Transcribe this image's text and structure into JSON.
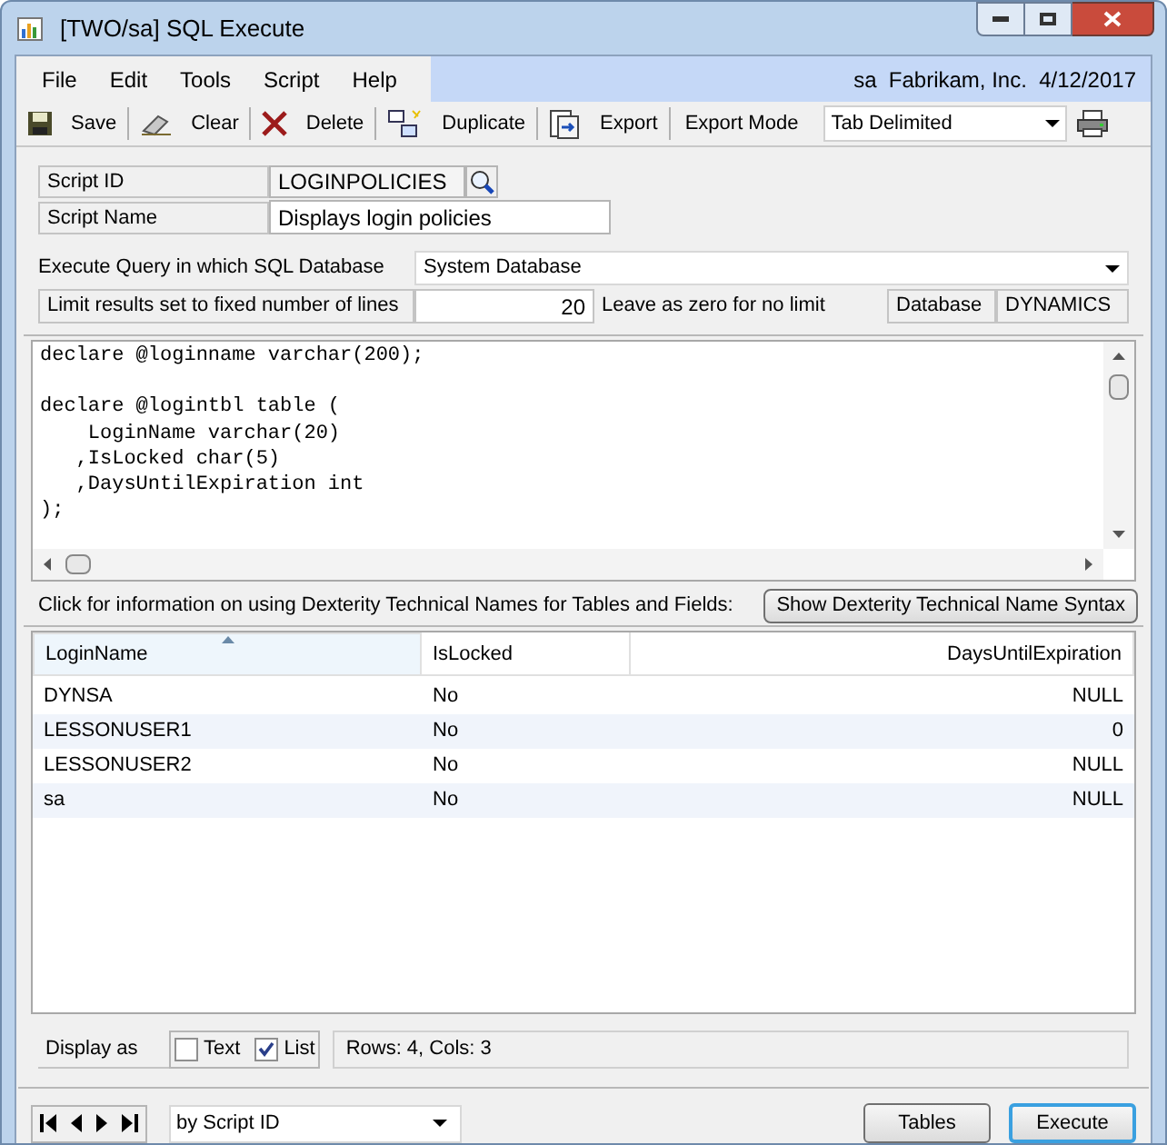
{
  "window": {
    "title": "[TWO/sa] SQL Execute"
  },
  "menu": [
    "File",
    "Edit",
    "Tools",
    "Script",
    "Help"
  ],
  "company_info": "sa  Fabrikam, Inc.  4/12/2017",
  "toolbar": [
    {
      "kind": "save",
      "label": "Save"
    },
    {
      "kind": "clear",
      "label": "Clear"
    },
    {
      "kind": "delete",
      "label": "Delete"
    },
    {
      "kind": "duplicate",
      "label": "Duplicate"
    },
    {
      "kind": "export",
      "label": "Export"
    }
  ],
  "export_mode": {
    "label": "Export Mode",
    "value": "Tab Delimited"
  },
  "script_id": {
    "label": "Script ID",
    "value": "LOGINPOLICIES"
  },
  "script_name": {
    "label": "Script Name",
    "value": "Displays login policies"
  },
  "database_select": {
    "label": "Execute Query in which SQL Database",
    "value": "System Database"
  },
  "limit": {
    "label": "Limit results set to fixed number of lines",
    "value": "20",
    "hint": "Leave as zero for no limit"
  },
  "database": {
    "label": "Database",
    "value": "DYNAMICS"
  },
  "query": "declare @loginname varchar(200);\n\ndeclare @logintbl table (\n    LoginName varchar(20)\n   ,IsLocked char(5)\n   ,DaysUntilExpiration int\n);",
  "info_text": "Click for information on using Dexterity Technical Names for Tables and Fields:",
  "syntax_button": "Show Dexterity Technical Name Syntax",
  "results": {
    "columns": [
      "LoginName",
      "IsLocked",
      "DaysUntilExpiration"
    ],
    "rows": [
      [
        "DYNSA",
        "No",
        "NULL"
      ],
      [
        "LESSONUSER1",
        "No",
        "0"
      ],
      [
        "LESSONUSER2",
        "No",
        "NULL"
      ],
      [
        "sa",
        "No",
        "NULL"
      ]
    ]
  },
  "display_as": {
    "label": "Display as",
    "options": [
      {
        "label": "Text",
        "checked": false
      },
      {
        "label": "List",
        "checked": true
      }
    ]
  },
  "status": "Rows: 4, Cols: 3",
  "sort_select": {
    "value": "by Script ID"
  },
  "buttons": [
    {
      "label": "Tables",
      "default": false
    },
    {
      "label": "Execute",
      "default": true
    }
  ]
}
